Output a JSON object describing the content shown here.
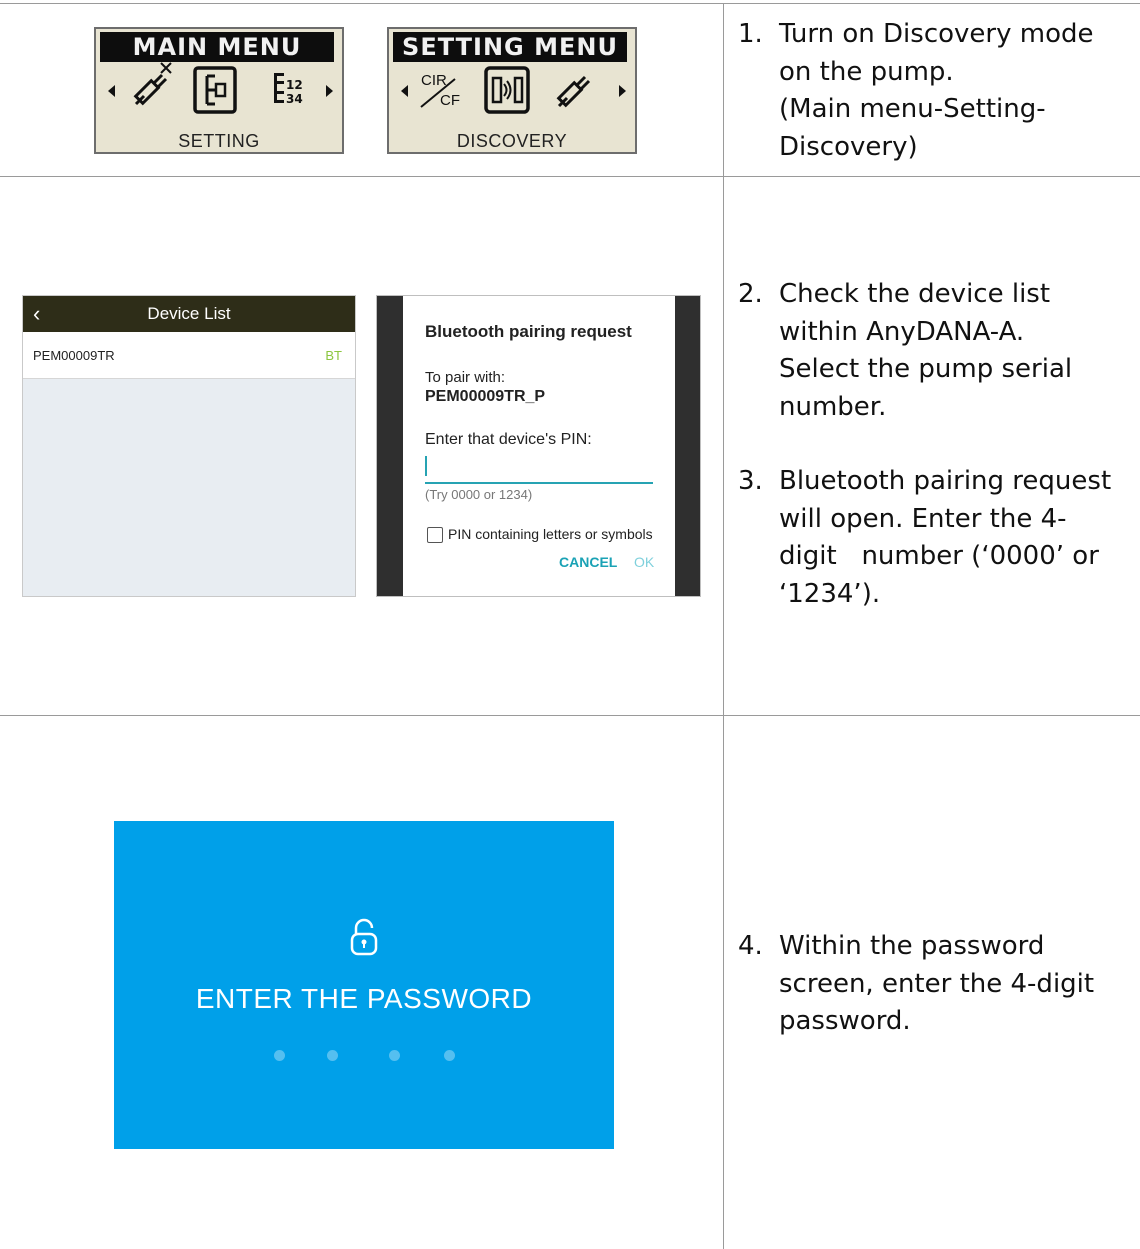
{
  "lcd_main": {
    "title": "MAIN MENU",
    "footer": "SETTING",
    "icons": [
      "syringe-cancel-icon",
      "setting-icon",
      "number-list-icon"
    ]
  },
  "lcd_setting": {
    "title": "SETTING MENU",
    "footer": "DISCOVERY",
    "cir_cf_top": "CIR",
    "cir_cf_bottom": "CF",
    "icons": [
      "cir-cf-icon",
      "discovery-icon",
      "syringe-icon"
    ]
  },
  "device_list": {
    "title": "Device List",
    "serial": "PEM00009TR",
    "status": "BT"
  },
  "pairing": {
    "title": "Bluetooth pairing request",
    "pair_with": "To pair with:",
    "device": "PEM00009TR_P",
    "enter_pin": "Enter that device's PIN:",
    "hint": "(Try 0000 or 1234)",
    "checkbox_label": "PIN containing letters or symbols",
    "cancel": "CANCEL",
    "ok": "OK"
  },
  "password": {
    "title": "ENTER THE PASSWORD",
    "dots": 4
  },
  "steps": [
    {
      "num": "1.",
      "lines": [
        "Turn on Discovery mode",
        "on the pump.",
        "(Main menu-Setting-",
        "Discovery)"
      ]
    },
    {
      "num": "2.",
      "lines": [
        "Check the device list",
        "within AnyDANA-A.",
        "Select the pump serial",
        "number."
      ]
    },
    {
      "num": "3.",
      "lines": [
        "Bluetooth pairing request",
        "will open. Enter the 4-",
        "digit   number (‘0000’ or",
        "‘1234’)."
      ]
    },
    {
      "num": "4.",
      "lines": [
        "Within the password",
        "screen, enter the 4-digit",
        "password."
      ]
    }
  ]
}
